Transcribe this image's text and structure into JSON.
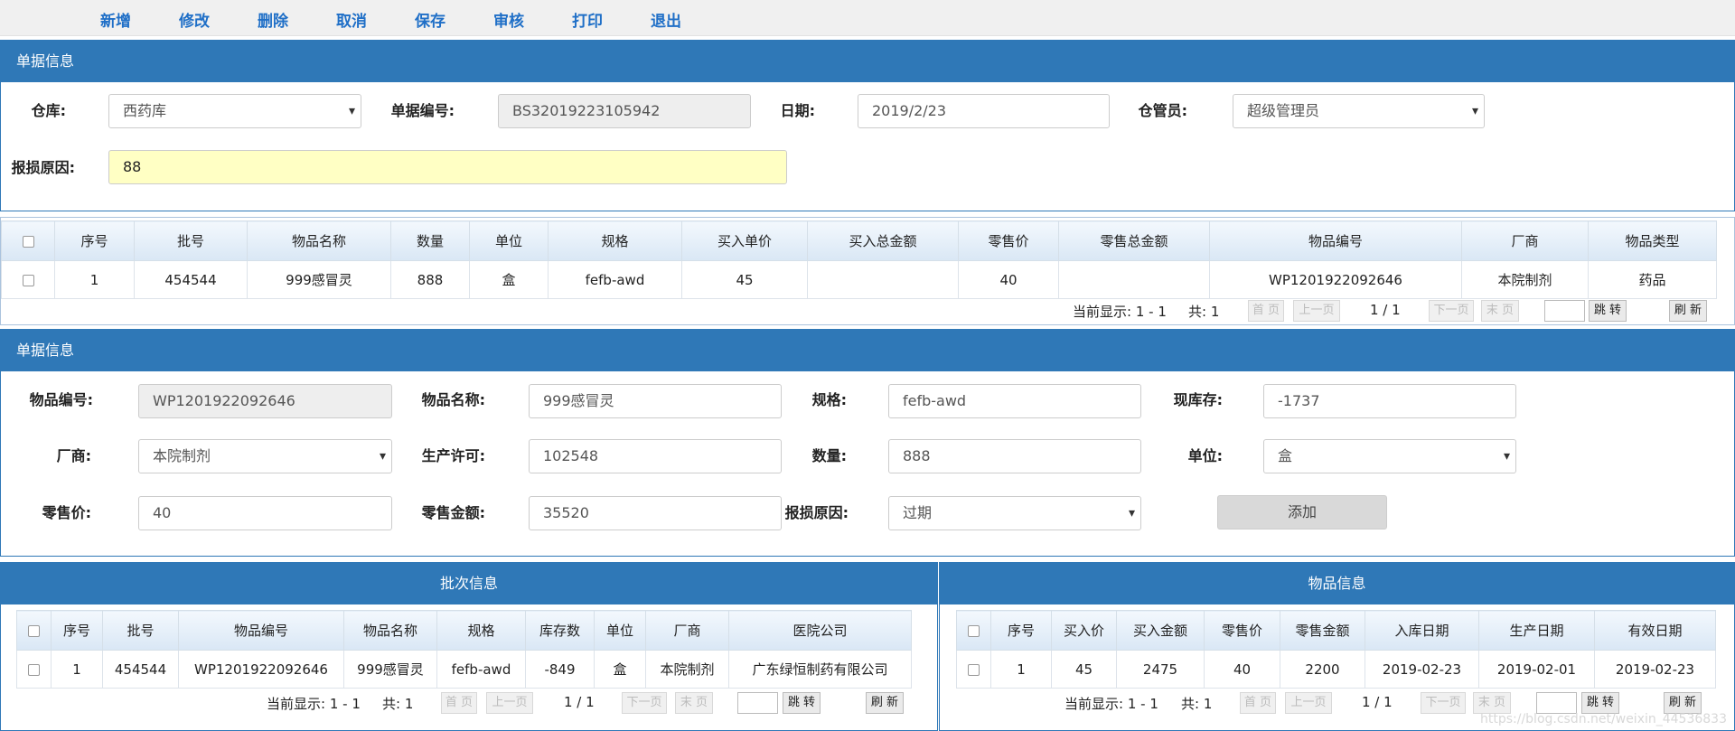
{
  "toolbar": {
    "add": "新增",
    "edit": "修改",
    "delete": "删除",
    "cancel": "取消",
    "save": "保存",
    "audit": "审核",
    "print": "打印",
    "exit": "退出"
  },
  "doc": {
    "title": "单据信息",
    "warehouse_label": "仓库:",
    "warehouse_value": "西药库",
    "docno_label": "单据编号:",
    "docno_value": "BS32019223105942",
    "date_label": "日期:",
    "date_value": "2019/2/23",
    "keeper_label": "仓管员:",
    "keeper_value": "超级管理员",
    "reason_label": "报损原因:",
    "reason_value": "88"
  },
  "grid1": {
    "headers": [
      "序号",
      "批号",
      "物品名称",
      "数量",
      "单位",
      "规格",
      "买入单价",
      "买入总金额",
      "零售价",
      "零售总金额",
      "物品编号",
      "厂商",
      "物品类型"
    ],
    "rows": [
      [
        "1",
        "454544",
        "999感冒灵",
        "888",
        "盒",
        "fefb-awd",
        "45",
        "",
        "40",
        "",
        "WP1201922092646",
        "本院制剂",
        "药品"
      ]
    ]
  },
  "pager": {
    "showing": "当前显示: 1 - 1",
    "total": "共: 1",
    "first": "首 页",
    "prev": "上一页",
    "page": "1 / 1",
    "next": "下一页",
    "last": "末 页",
    "jump": "跳 转",
    "refresh": "刷 新"
  },
  "item": {
    "title": "单据信息",
    "code_label": "物品编号:",
    "code_value": "WP1201922092646",
    "name_label": "物品名称:",
    "name_value": "999感冒灵",
    "spec_label": "规格:",
    "spec_value": "fefb-awd",
    "stock_label": "现库存:",
    "stock_value": "-1737",
    "vendor_label": "厂商:",
    "vendor_value": "本院制剂",
    "license_label": "生产许可:",
    "license_value": "102548",
    "qty_label": "数量:",
    "qty_value": "888",
    "unit_label": "单位:",
    "unit_value": "盒",
    "price_label": "零售价:",
    "price_value": "40",
    "amount_label": "零售金额:",
    "amount_value": "35520",
    "reason_label": "报损原因:",
    "reason_value": "过期",
    "add_button": "添加"
  },
  "batch": {
    "title": "批次信息",
    "headers": [
      "序号",
      "批号",
      "物品编号",
      "物品名称",
      "规格",
      "库存数",
      "单位",
      "厂商",
      "医院公司"
    ],
    "rows": [
      [
        "1",
        "454544",
        "WP1201922092646",
        "999感冒灵",
        "fefb-awd",
        "-849",
        "盒",
        "本院制剂",
        "广东绿恒制药有限公司"
      ]
    ]
  },
  "goods": {
    "title": "物品信息",
    "headers": [
      "序号",
      "买入价",
      "买入金额",
      "零售价",
      "零售金额",
      "入库日期",
      "生产日期",
      "有效日期"
    ],
    "rows": [
      [
        "1",
        "45",
        "2475",
        "40",
        "2200",
        "2019-02-23",
        "2019-02-01",
        "2019-02-23"
      ]
    ]
  },
  "watermark": "https://blog.csdn.net/weixin_44536833"
}
